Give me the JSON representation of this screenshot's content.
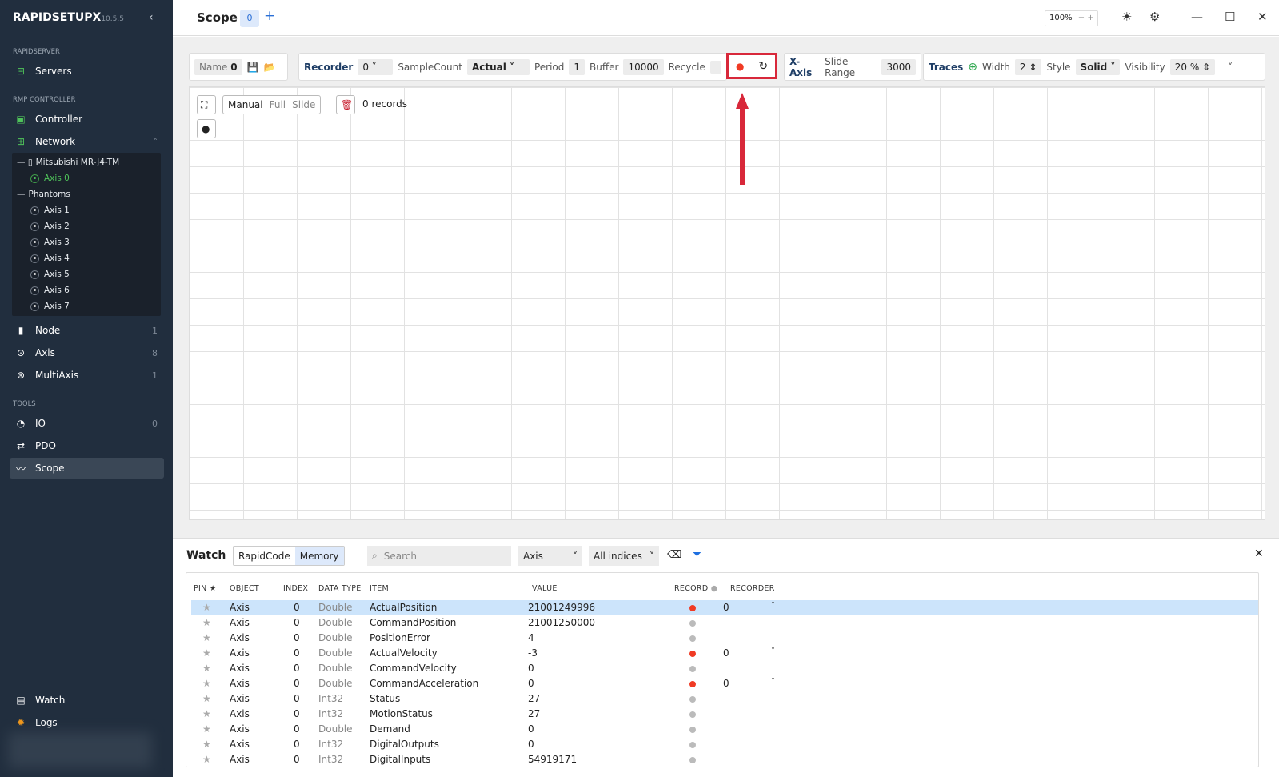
{
  "app": {
    "name": "RAPIDSETUPX",
    "version": "10.5.5"
  },
  "sidebar": {
    "sections": [
      "RAPIDSERVER",
      "RMP CONTROLLER",
      "TOOLS"
    ],
    "servers": "Servers",
    "controller": "Controller",
    "network": "Network",
    "tree": {
      "device": "Mitsubishi MR-J4-TM",
      "device_axis": "Axis 0",
      "phantoms": "Phantoms",
      "phantom_axes": [
        "Axis 1",
        "Axis 2",
        "Axis 3",
        "Axis 4",
        "Axis 5",
        "Axis 6",
        "Axis 7"
      ]
    },
    "node": {
      "label": "Node",
      "count": "1"
    },
    "axis": {
      "label": "Axis",
      "count": "8"
    },
    "multiaxis": {
      "label": "MultiAxis",
      "count": "1"
    },
    "io": {
      "label": "IO",
      "count": "0"
    },
    "pdo": "PDO",
    "scope": "Scope",
    "watch": "Watch",
    "logs": "Logs"
  },
  "header": {
    "title": "Scope",
    "tab_count": "0",
    "zoom": "100%"
  },
  "toolbar": {
    "name_label": "Name",
    "name_value": "0",
    "recorder_label": "Recorder",
    "recorder_value": "0",
    "samplecount_label": "SampleCount",
    "samplecount_value": "Actual",
    "period_label": "Period",
    "period_value": "1",
    "buffer_label": "Buffer",
    "buffer_value": "10000",
    "recycle_label": "Recycle",
    "xaxis_label": "X-Axis",
    "slide_range_label": "Slide Range",
    "slide_range_value": "3000",
    "traces_label": "Traces",
    "width_label": "Width",
    "width_value": "2",
    "style_label": "Style",
    "style_value": "Solid",
    "visibility_label": "Visibility",
    "visibility_value": "20 %"
  },
  "chart_controls": {
    "modes": [
      "Manual",
      "Full",
      "Slide"
    ],
    "active_mode": "Manual",
    "records": "0 records"
  },
  "chart_data": {
    "type": "line",
    "x_ticks": [
      "-10",
      "-9",
      "-8",
      "-7",
      "-6",
      "-5",
      "-4",
      "-3",
      "-2",
      "-1",
      "0",
      "1",
      "2",
      "3",
      "4",
      "5",
      "6",
      "7",
      "8",
      "9",
      "10"
    ],
    "xlim": [
      -10,
      10
    ],
    "grid": true,
    "series": []
  },
  "watch": {
    "title": "Watch",
    "tabs": [
      "RapidCode",
      "Memory"
    ],
    "active_tab": "Memory",
    "search_placeholder": "Search",
    "object_filter": "Axis",
    "index_filter": "All indices",
    "columns": [
      "PIN",
      "OBJECT",
      "INDEX",
      "DATA TYPE",
      "ITEM",
      "VALUE",
      "RECORD",
      "RECORDER"
    ],
    "rows": [
      {
        "object": "Axis",
        "index": "0",
        "type": "Double",
        "item": "ActualPosition",
        "value": "21001249996",
        "record": true,
        "recorder": "0"
      },
      {
        "object": "Axis",
        "index": "0",
        "type": "Double",
        "item": "CommandPosition",
        "value": "21001250000",
        "record": false,
        "recorder": ""
      },
      {
        "object": "Axis",
        "index": "0",
        "type": "Double",
        "item": "PositionError",
        "value": "4",
        "record": false,
        "recorder": ""
      },
      {
        "object": "Axis",
        "index": "0",
        "type": "Double",
        "item": "ActualVelocity",
        "value": "-3",
        "record": true,
        "recorder": "0"
      },
      {
        "object": "Axis",
        "index": "0",
        "type": "Double",
        "item": "CommandVelocity",
        "value": "0",
        "record": false,
        "recorder": ""
      },
      {
        "object": "Axis",
        "index": "0",
        "type": "Double",
        "item": "CommandAcceleration",
        "value": "0",
        "record": true,
        "recorder": "0"
      },
      {
        "object": "Axis",
        "index": "0",
        "type": "Int32",
        "item": "Status",
        "value": "27",
        "record": false,
        "recorder": ""
      },
      {
        "object": "Axis",
        "index": "0",
        "type": "Int32",
        "item": "MotionStatus",
        "value": "27",
        "record": false,
        "recorder": ""
      },
      {
        "object": "Axis",
        "index": "0",
        "type": "Double",
        "item": "Demand",
        "value": "0",
        "record": false,
        "recorder": ""
      },
      {
        "object": "Axis",
        "index": "0",
        "type": "Int32",
        "item": "DigitalOutputs",
        "value": "0",
        "record": false,
        "recorder": ""
      },
      {
        "object": "Axis",
        "index": "0",
        "type": "Int32",
        "item": "DigitalInputs",
        "value": "54919171",
        "record": false,
        "recorder": ""
      }
    ]
  },
  "colors": {
    "sidebar": "#212e3e",
    "accent": "#2a6fd6",
    "record_on": "#f03a24",
    "record_off": "#bbbbbb",
    "highlight": "#d8283a",
    "green": "#4fc35a"
  }
}
